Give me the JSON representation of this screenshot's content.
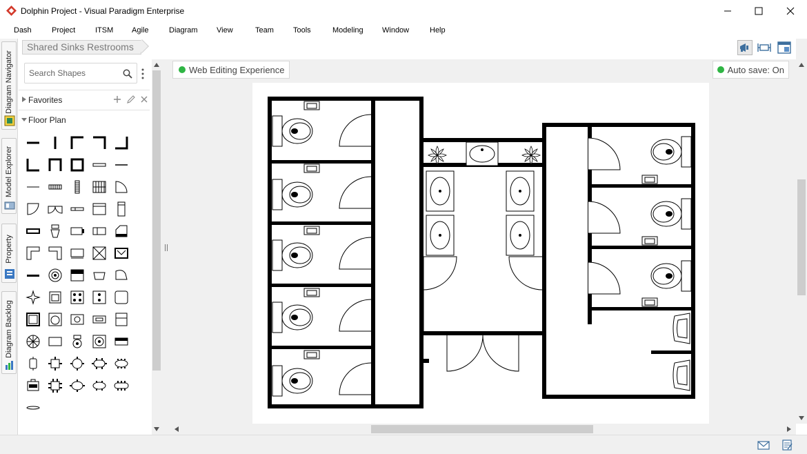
{
  "window": {
    "title": "Dolphin Project - Visual Paradigm Enterprise",
    "controls": [
      "minimize",
      "maximize",
      "close"
    ]
  },
  "menu": [
    "Dash",
    "Project",
    "ITSM",
    "Agile",
    "Diagram",
    "View",
    "Team",
    "Tools",
    "Modeling",
    "Window",
    "Help"
  ],
  "side_tabs": [
    "Diagram Navigator",
    "Model Explorer",
    "Property",
    "Diagram Backlog"
  ],
  "breadcrumb": "Shared Sinks Restrooms",
  "palette": {
    "search_placeholder": "Search Shapes",
    "sections": [
      {
        "label": "Favorites",
        "expanded": false
      },
      {
        "label": "Floor Plan",
        "expanded": true
      }
    ]
  },
  "canvas": {
    "web_editing_label": "Web Editing Experience",
    "autosave_label": "Auto save: On",
    "status_color": "#2fb544"
  },
  "colors": {
    "accent": "#2fb544",
    "wall": "#000000",
    "brand_icon": "#d33a2c"
  }
}
